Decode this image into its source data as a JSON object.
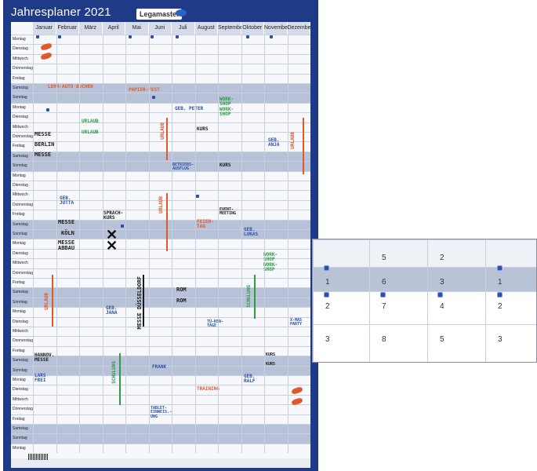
{
  "poster": {
    "title": "Jahresplaner 2021",
    "brand": "Legamaster",
    "months": [
      "Januar",
      "Februar",
      "März",
      "April",
      "Mai",
      "Juni",
      "Juli",
      "August",
      "September",
      "Oktober",
      "November",
      "Dezember"
    ],
    "day_names": [
      "Montag",
      "Dienstag",
      "Mittwoch",
      "Donnerstag",
      "Freitag",
      "Samstag",
      "Sonntag"
    ]
  },
  "notes": {
    "lehrauto": "LEHR-AUTO BUCHEN",
    "papier": "PAPIER-FEST",
    "geb_peter": "GEB. PETER",
    "workshop1": "WORK-SHOP WORK-SHOP",
    "messe1": "MESSE",
    "berlin": "BERLIN",
    "messe2": "MESSE",
    "urlaub_feb1": "URLAUB",
    "urlaub_feb2": "URLAUB",
    "urlaub_jun": "URLAUB",
    "kurs1": "KURS",
    "geb_anja": "GEB. ANJA",
    "urlaub_dez": "URLAUB",
    "betriebsausflug": "BETRIEBS-AUSFLUG",
    "kurs2": "KURS",
    "geb_jutta": "GEB. JUTTA",
    "sprachkurs": "SPRACH-KURS",
    "messe3": "MESSE",
    "koeln": "KÖLN",
    "messe4": "MESSE ABBAU",
    "urlaub_jun2": "URLAUB",
    "event": "EVENT-MEETING",
    "feiertag": "FEIER-TAG",
    "geb_lukas": "GEB. LUKAS",
    "workshop2": "WORK-SHOP WORK-SHOP",
    "urlaub_jan": "URLAUB",
    "geb_jana": "GEB. JANA",
    "messe_duesseldorf": "MESSE DÜSSELDORF",
    "rom1": "ROM",
    "rom2": "ROM",
    "schulung1": "SCHULUNG",
    "tuerkei": "TÜ-KEN-TAGE",
    "xmas": "X-MAS PARTY",
    "hannover": "HANNOV. MESSE",
    "lars": "LARS FREI",
    "schulung2": "SCHULUNG",
    "frank": "FRANK",
    "training": "TRAINING",
    "geb_ralf": "GEB. RALF",
    "kurs3": "KURS",
    "kurs4": "KURS",
    "tablet": "TABLET-EINWEIS.-UNG"
  },
  "zoom": {
    "rows": [
      [
        "",
        "5",
        "2",
        ""
      ],
      [
        "1",
        "6",
        "3",
        "1"
      ],
      [
        "2",
        "7",
        "4",
        "2"
      ],
      [
        "3",
        "8",
        "5",
        "3"
      ]
    ]
  },
  "colors": {
    "frame": "#1f3a86",
    "weekend": "#b7c2d8",
    "magnet_blue": "#2b50a8",
    "orange": "#e0592a",
    "green": "#2f9b45"
  }
}
